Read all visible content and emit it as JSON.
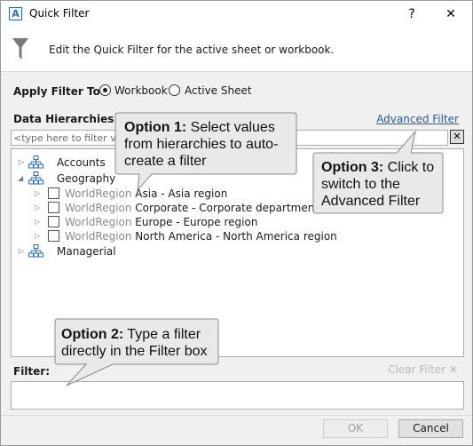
{
  "window": {
    "app_icon_letter": "A",
    "title": "Quick Filter",
    "help_label": "?",
    "close_label": "✕"
  },
  "header": {
    "text": "Edit the Quick Filter for the active sheet or workbook."
  },
  "apply_filter": {
    "label": "Apply Filter To:",
    "options": [
      {
        "label": "Workbook",
        "selected": true
      },
      {
        "label": "Active Sheet",
        "selected": false
      }
    ]
  },
  "hierarchies": {
    "label": "Data Hierarchies",
    "advanced_link": "Advanced Filter",
    "search_placeholder": "<type here to filter values>",
    "clear_search": "✕",
    "tree": [
      {
        "label": "Accounts",
        "expanded": false
      },
      {
        "label": "Geography",
        "expanded": true,
        "children": [
          {
            "type": "WorldRegion",
            "label": "Asia - Asia region"
          },
          {
            "type": "WorldRegion",
            "label": "Corporate - Corporate departments"
          },
          {
            "type": "WorldRegion",
            "label": "Europe - Europe region"
          },
          {
            "type": "WorldRegion",
            "label": "North America - North America region"
          }
        ]
      },
      {
        "label": "Managerial",
        "expanded": false
      }
    ]
  },
  "filter": {
    "label": "Filter:",
    "clear_label": "Clear Filter ✕",
    "value": ""
  },
  "buttons": {
    "ok": "OK",
    "cancel": "Cancel"
  },
  "callouts": {
    "option1": {
      "bold": "Option 1:",
      "text": " Select values from hierarchies to auto-create a filter"
    },
    "option2": {
      "bold": "Option 2:",
      "text": " Type a filter directly in the Filter box"
    },
    "option3": {
      "bold": "Option 3:",
      "text": " Click to switch to the Advanced Filter"
    }
  },
  "colors": {
    "link": "#1a5fb4",
    "hierarchy_icon": "#2b6cb8",
    "callout_fill": "#e9e9e9"
  }
}
